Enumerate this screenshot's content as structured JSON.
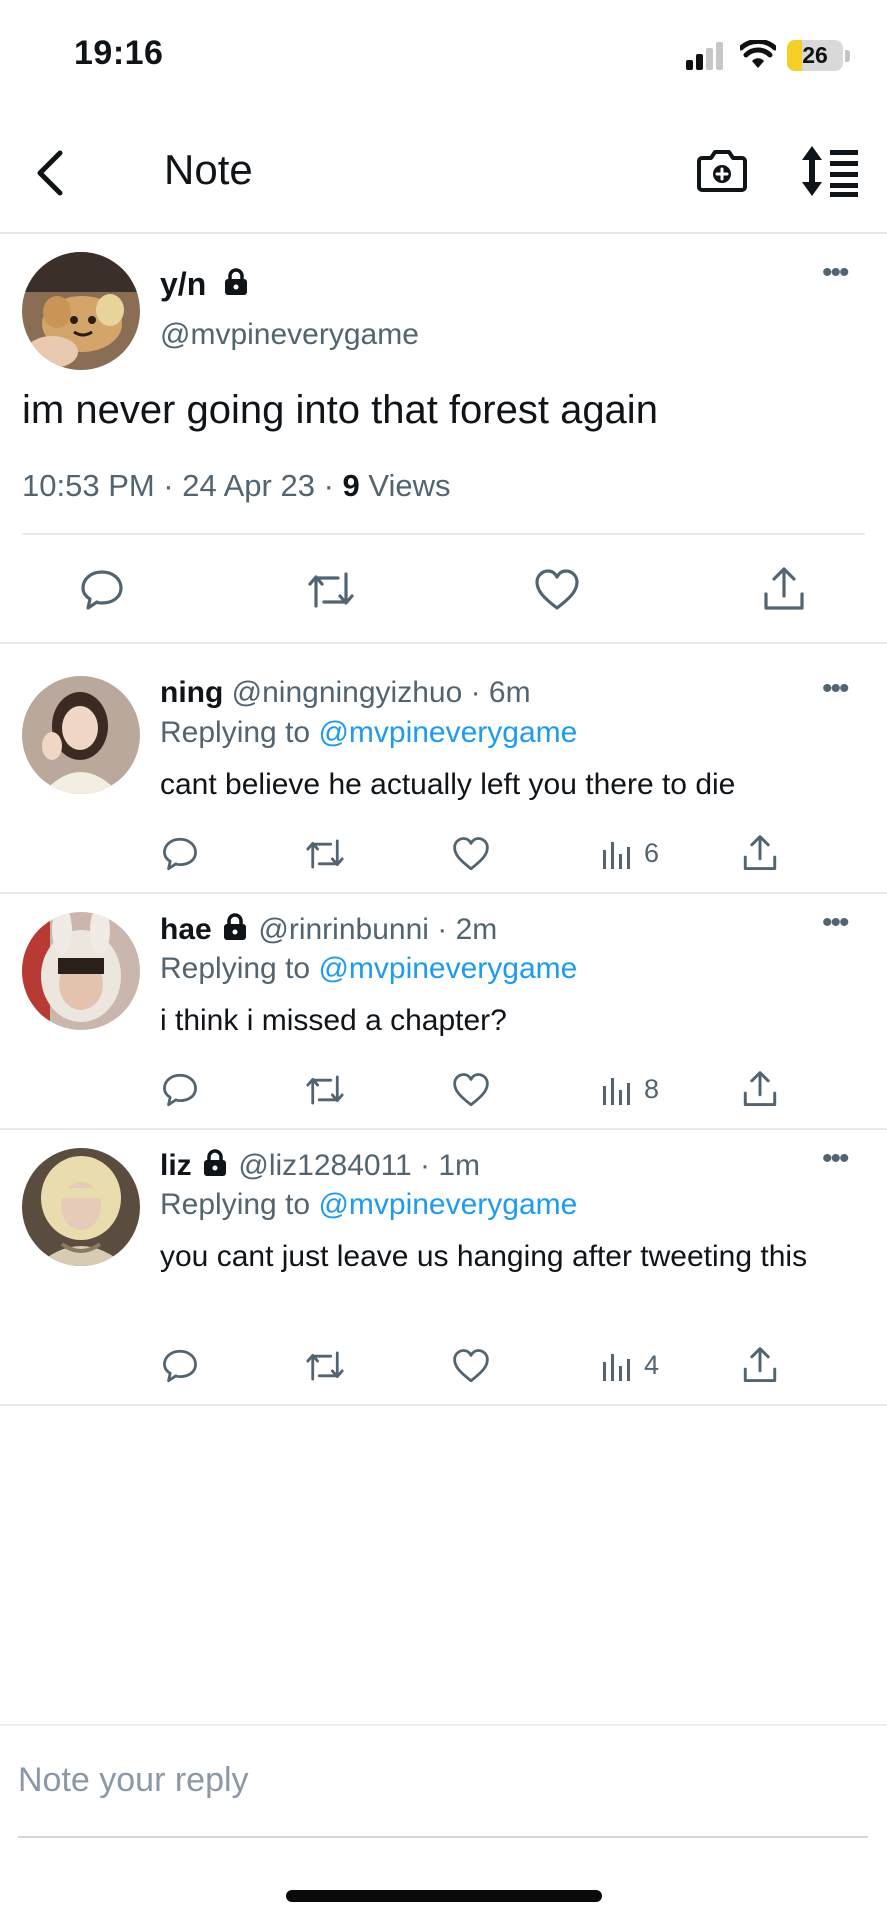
{
  "status_bar": {
    "time": "19:16",
    "battery": "26",
    "battery_level": 0.26
  },
  "nav": {
    "title": "Note"
  },
  "main_post": {
    "name": "y/n",
    "handle": "@mvpineverygame",
    "text": "im never going into that forest again",
    "time": "10:53 PM · 24 Apr 23 · ",
    "views_count": "9",
    "views_label": " Views",
    "more": "•••"
  },
  "replies": [
    {
      "name": "ning",
      "handle": "@ningningyizhuo · 6m",
      "replying_prefix": "Replying to ",
      "replying_to": "@mvpineverygame",
      "text": "cant believe he actually left you there to die",
      "views": "6",
      "more": "•••"
    },
    {
      "name": "hae",
      "handle": "@rinrinbunni · 2m",
      "replying_prefix": "Replying to ",
      "replying_to": "@mvpineverygame",
      "text": "i think i missed a chapter?",
      "views": "8",
      "more": "•••"
    },
    {
      "name": "liz",
      "handle": "@liz1284011 · 1m",
      "replying_prefix": "Replying to ",
      "replying_to": "@mvpineverygame",
      "text": "you cant just leave us hanging after tweeting this",
      "views": "4",
      "more": "•••"
    }
  ],
  "composer": {
    "placeholder": "Note your reply"
  },
  "colors": {
    "link": "#1d9bf0",
    "secondary": "#536471",
    "text": "#0f1419",
    "battery": "#f6cf26"
  },
  "icons": [
    "back-icon",
    "camera-plus-icon",
    "sort-icon",
    "lock-icon",
    "reply-icon",
    "retweet-icon",
    "like-icon",
    "views-icon",
    "share-icon",
    "more-icon"
  ]
}
